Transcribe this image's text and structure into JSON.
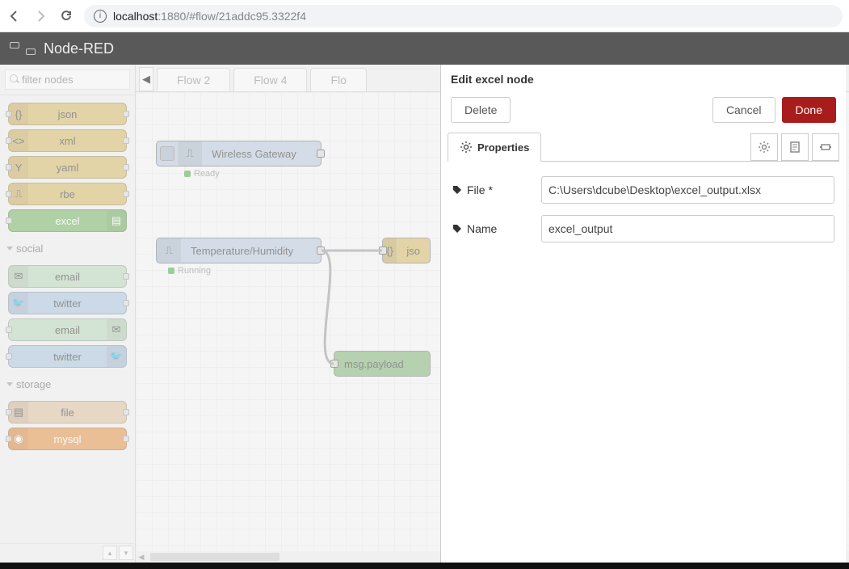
{
  "browser": {
    "url_host": "localhost",
    "url_port": ":1880",
    "url_path": "/#flow/21addc95.3322f4"
  },
  "header": {
    "title": "Node-RED"
  },
  "palette": {
    "search_placeholder": "filter nodes",
    "nodes_top": [
      "json",
      "xml",
      "yaml",
      "rbe",
      "excel"
    ],
    "cat_social": "social",
    "social_nodes": [
      "email",
      "twitter",
      "email",
      "twitter"
    ],
    "cat_storage": "storage",
    "storage_nodes": [
      "file",
      "mysql"
    ]
  },
  "workspace": {
    "tabs": [
      "Flow 2",
      "Flow 4",
      "Flo"
    ],
    "nodes": {
      "gateway": {
        "label": "Wireless Gateway",
        "status": "Ready"
      },
      "temp": {
        "label": "Temperature/Humidity",
        "status": "Running"
      },
      "json": {
        "label": "jso"
      },
      "debug": {
        "label": "msg.payload"
      }
    }
  },
  "edit": {
    "title": "Edit excel node",
    "delete": "Delete",
    "cancel": "Cancel",
    "done": "Done",
    "properties_tab": "Properties",
    "file_label": "File *",
    "file_value": "C:\\Users\\dcube\\Desktop\\excel_output.xlsx",
    "name_label": "Name",
    "name_value": "excel_output"
  }
}
